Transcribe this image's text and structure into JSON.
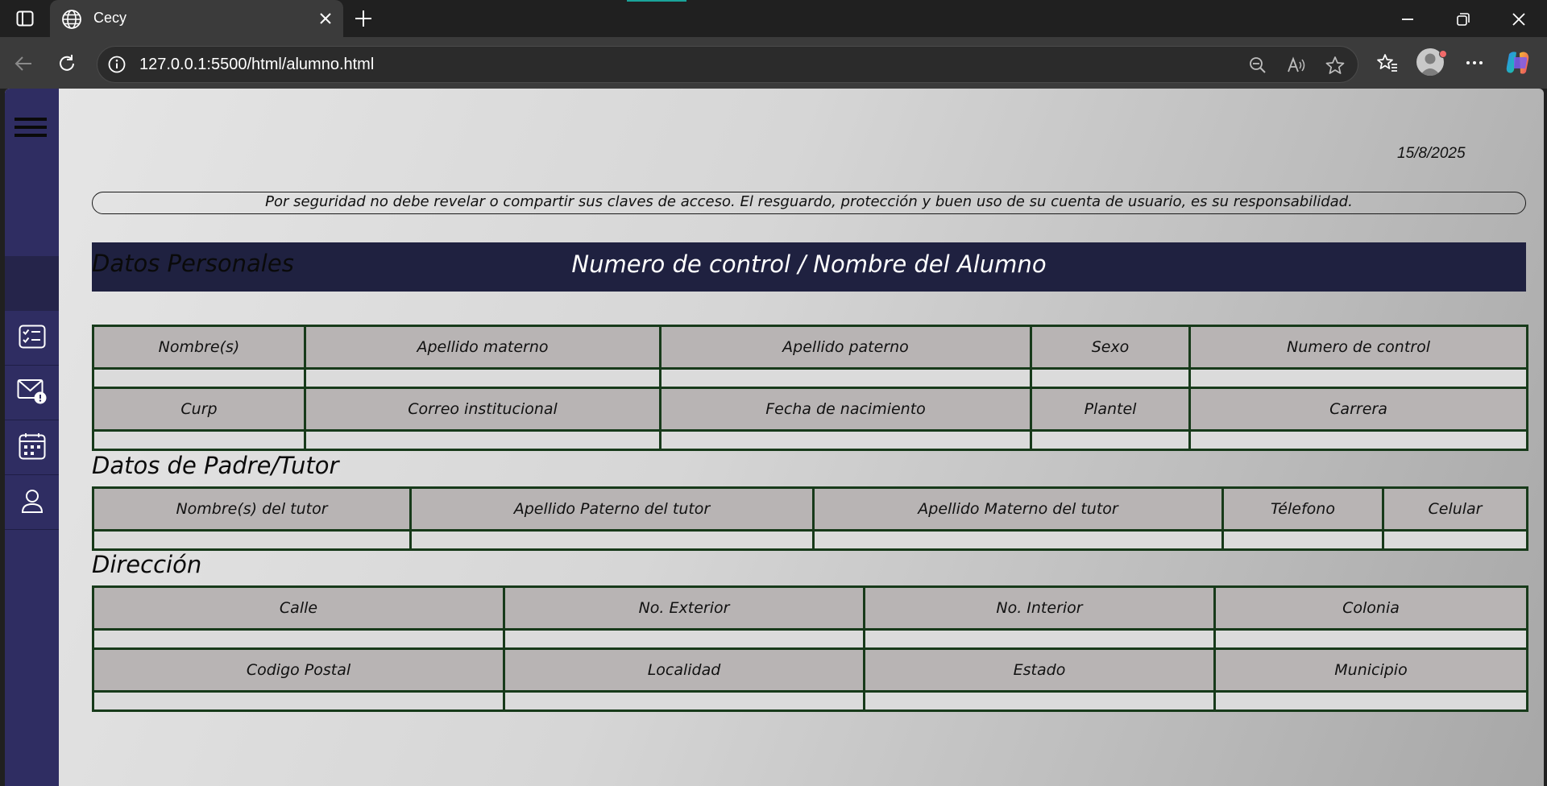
{
  "browser": {
    "tab_title": "Cecy",
    "url": "127.0.0.1:5500/html/alumno.html"
  },
  "page": {
    "date": "15/8/2025",
    "notice": "Por seguridad no debe revelar o compartir sus claves de acceso. El resguardo, protección y buen uso de su cuenta de usuario, es su responsabilidad.",
    "banner": "Numero de control / Nombre del Alumno",
    "sidebar": {
      "items": [
        {
          "icon": "checklist-icon"
        },
        {
          "icon": "mail-alert-icon"
        },
        {
          "icon": "calendar-icon"
        },
        {
          "icon": "user-icon"
        }
      ]
    },
    "personal": {
      "title": "Datos Personales",
      "row1": [
        "Nombre(s)",
        "Apellido materno",
        "Apellido paterno",
        "Sexo",
        "Numero de control"
      ],
      "row2": [
        "Curp",
        "Correo institucional",
        "Fecha de nacimiento",
        "Plantel",
        "Carrera"
      ]
    },
    "tutor": {
      "title": "Datos de Padre/Tutor",
      "row1": [
        "Nombre(s) del tutor",
        "Apellido Paterno del tutor",
        "Apellido Materno del tutor",
        "Télefono",
        "Celular"
      ]
    },
    "address": {
      "title": "Dirección",
      "row1": [
        "Calle",
        "No. Exterior",
        "No. Interior",
        "Colonia"
      ],
      "row2": [
        "Codigo Postal",
        "Localidad",
        "Estado",
        "Municipio"
      ]
    }
  }
}
